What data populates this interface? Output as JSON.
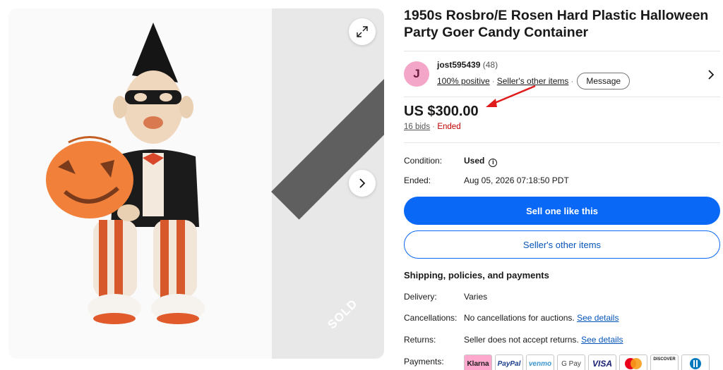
{
  "listing": {
    "title": "1950s Rosbro/E Rosen Hard Plastic Halloween Party Goer Candy Container",
    "sold_label": "SOLD"
  },
  "seller": {
    "avatar_initial": "J",
    "username": "jost595439",
    "feedback_count": "(48)",
    "positive": "100% positive",
    "other_items": "Seller's other items",
    "message_label": "Message"
  },
  "pricing": {
    "price": "US $300.00",
    "bids": "16 bids",
    "separator": "·",
    "status": "Ended"
  },
  "details": {
    "condition_label": "Condition:",
    "condition_value": "Used",
    "ended_label": "Ended:",
    "ended_value": "Aug 05, 2026 07:18:50 PDT"
  },
  "actions": {
    "sell_one": "Sell one like this",
    "sellers_other": "Seller's other items"
  },
  "shipping": {
    "section_title": "Shipping, policies, and payments",
    "delivery_label": "Delivery:",
    "delivery_value": "Varies",
    "cancellations_label": "Cancellations:",
    "cancellations_value": "No cancellations for auctions.",
    "returns_label": "Returns:",
    "returns_value": "Seller does not accept returns.",
    "see_details": "See details",
    "payments_label": "Payments:"
  },
  "payments": [
    {
      "name": "Klarna",
      "icon": "klarna-icon"
    },
    {
      "name": "PayPal",
      "icon": "paypal-icon"
    },
    {
      "name": "venmo",
      "icon": "venmo-icon"
    },
    {
      "name": "G Pay",
      "icon": "google-pay-icon"
    },
    {
      "name": "VISA",
      "icon": "visa-icon"
    },
    {
      "name": "",
      "icon": "mastercard-icon"
    },
    {
      "name": "DISCOVER",
      "icon": "discover-icon"
    },
    {
      "name": "",
      "icon": "diners-club-icon"
    }
  ],
  "colors": {
    "primary_blue": "#0968f6",
    "link_blue": "#0654ba",
    "ended_red": "#c00000",
    "sold_ribbon": "#5f5f5f"
  }
}
